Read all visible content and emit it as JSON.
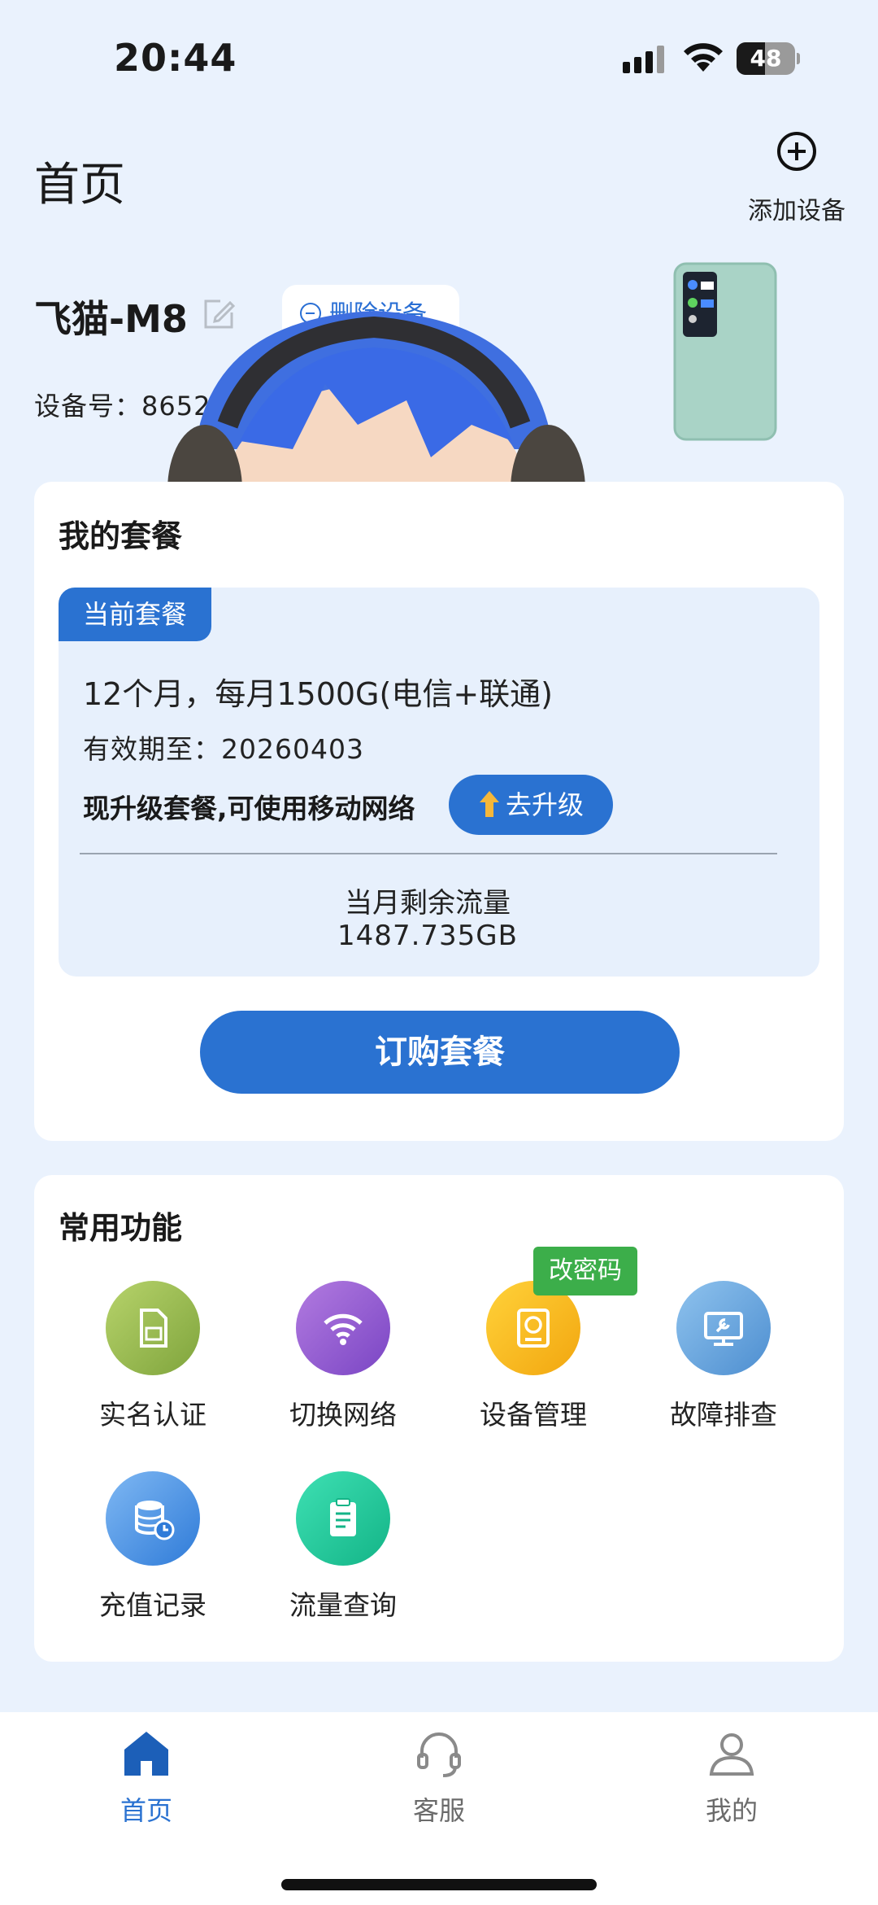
{
  "status_bar": {
    "time": "20:44",
    "battery_level": 48,
    "battery_text": "48"
  },
  "header": {
    "title": "首页",
    "add_device_label": "添加设备"
  },
  "device": {
    "name": "飞猫-M8",
    "delete_label": "删除设备",
    "id_text": "设备号：8652"
  },
  "plan": {
    "heading": "我的套餐",
    "tag": "当前套餐",
    "description": "12个月，每月1500G(电信+联通)",
    "expiry": "有效期至：20260403",
    "upgrade_text": "现升级套餐,可使用移动网络",
    "upgrade_button": "去升级",
    "remaining_label": "当月剩余流量",
    "remaining_value": "1487.735GB",
    "order_button": "订购套餐"
  },
  "functions": {
    "heading": "常用功能",
    "badge": "改密码",
    "items": [
      {
        "label": "实名认证",
        "icon": "sim-card-icon"
      },
      {
        "label": "切换网络",
        "icon": "wifi-icon"
      },
      {
        "label": "设备管理",
        "icon": "device-manage-icon"
      },
      {
        "label": "故障排查",
        "icon": "troubleshoot-icon"
      },
      {
        "label": "充值记录",
        "icon": "recharge-record-icon"
      },
      {
        "label": "流量查询",
        "icon": "data-query-icon"
      }
    ]
  },
  "nav": {
    "items": [
      {
        "label": "首页",
        "icon": "home-icon",
        "active": true
      },
      {
        "label": "客服",
        "icon": "headset-icon",
        "active": false
      },
      {
        "label": "我的",
        "icon": "user-icon",
        "active": false
      }
    ]
  },
  "colors": {
    "primary": "#2a72d1",
    "background": "#eaf2fd",
    "badge_green": "#3cae4a",
    "nav_inactive": "#6b6b6b"
  }
}
